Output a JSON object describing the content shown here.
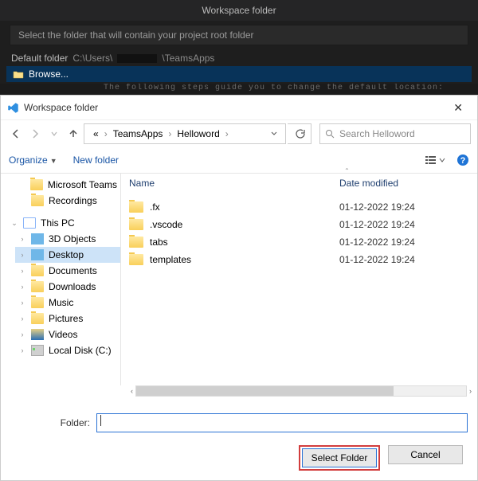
{
  "vscode": {
    "title": "Workspace folder",
    "prompt": "Select the folder that will contain your project root folder",
    "default_label": "Default folder",
    "default_path_prefix": "C:\\Users\\",
    "default_path_suffix": "\\TeamsApps",
    "browse_label": "Browse...",
    "bg_text": "The following steps guide you to change the default location:"
  },
  "dialog": {
    "title": "Workspace folder",
    "close": "✕",
    "breadcrumb": {
      "seg1": "«",
      "seg2": "TeamsApps",
      "seg3": "Helloword"
    },
    "search_placeholder": "Search Helloword",
    "organize": "Organize",
    "new_folder": "New folder",
    "columns": {
      "name": "Name",
      "date": "Date modified"
    },
    "sidebar": {
      "items": [
        {
          "label": "Microsoft Teams"
        },
        {
          "label": "Recordings"
        }
      ],
      "this_pc": "This PC",
      "pc_items": [
        {
          "label": "3D Objects"
        },
        {
          "label": "Desktop"
        },
        {
          "label": "Documents"
        },
        {
          "label": "Downloads"
        },
        {
          "label": "Music"
        },
        {
          "label": "Pictures"
        },
        {
          "label": "Videos"
        },
        {
          "label": "Local Disk (C:)"
        }
      ]
    },
    "files": [
      {
        "name": ".fx",
        "date": "01-12-2022 19:24"
      },
      {
        "name": ".vscode",
        "date": "01-12-2022 19:24"
      },
      {
        "name": "tabs",
        "date": "01-12-2022 19:24"
      },
      {
        "name": "templates",
        "date": "01-12-2022 19:24"
      }
    ],
    "folder_label": "Folder:",
    "folder_value": "",
    "select_btn": "Select Folder",
    "cancel_btn": "Cancel"
  }
}
